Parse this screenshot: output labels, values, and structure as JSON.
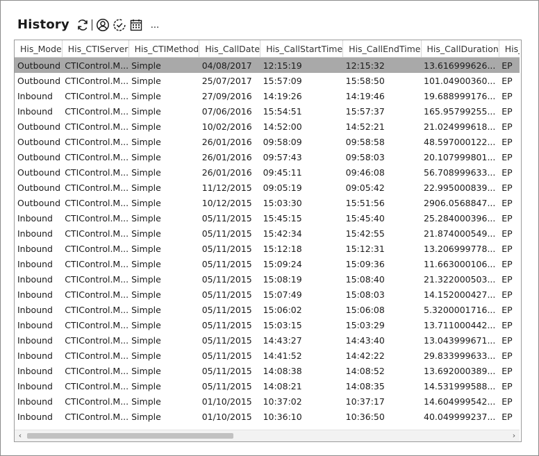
{
  "title": "History",
  "toolbar": {
    "buttons": [
      {
        "name": "refresh-icon"
      },
      {
        "name": "user-circle-icon"
      },
      {
        "name": "check-circle-icon"
      },
      {
        "name": "calendar-icon"
      }
    ],
    "more_label": "..."
  },
  "grid": {
    "columns": [
      "His_Mode",
      "His_CTIServer",
      "His_CTIMethod",
      "His_CallDate",
      "His_CallStartTime",
      "His_CallEndTime",
      "His_CallDuration",
      "His_"
    ],
    "selected_row": 0,
    "rows": [
      [
        "Outbound",
        "CTIControl.M...",
        "Simple",
        "04/08/2017",
        "12:15:19",
        "12:15:32",
        "13.616999626...",
        "EP"
      ],
      [
        "Outbound",
        "CTIControl.M...",
        "Simple",
        "25/07/2017",
        "15:57:09",
        "15:58:50",
        "101.04900360...",
        "EP"
      ],
      [
        "Inbound",
        "CTIControl.M...",
        "Simple",
        "27/09/2016",
        "14:19:26",
        "14:19:46",
        "19.688999176...",
        "EP"
      ],
      [
        "Inbound",
        "CTIControl.M...",
        "Simple",
        "07/06/2016",
        "15:54:51",
        "15:57:37",
        "165.95799255...",
        "EP"
      ],
      [
        "Outbound",
        "CTIControl.M...",
        "Simple",
        "10/02/2016",
        "14:52:00",
        "14:52:21",
        "21.024999618...",
        "EP"
      ],
      [
        "Outbound",
        "CTIControl.M...",
        "Simple",
        "26/01/2016",
        "09:58:09",
        "09:58:58",
        "48.597000122...",
        "EP"
      ],
      [
        "Outbound",
        "CTIControl.M...",
        "Simple",
        "26/01/2016",
        "09:57:43",
        "09:58:03",
        "20.107999801...",
        "EP"
      ],
      [
        "Outbound",
        "CTIControl.M...",
        "Simple",
        "26/01/2016",
        "09:45:11",
        "09:46:08",
        "56.708999633...",
        "EP"
      ],
      [
        "Outbound",
        "CTIControl.M...",
        "Simple",
        "11/12/2015",
        "09:05:19",
        "09:05:42",
        "22.995000839...",
        "EP"
      ],
      [
        "Outbound",
        "CTIControl.M...",
        "Simple",
        "10/12/2015",
        "15:03:30",
        "15:51:56",
        "2906.0568847...",
        "EP"
      ],
      [
        "Inbound",
        "CTIControl.M...",
        "Simple",
        "05/11/2015",
        "15:45:15",
        "15:45:40",
        "25.284000396...",
        "EP"
      ],
      [
        "Inbound",
        "CTIControl.M...",
        "Simple",
        "05/11/2015",
        "15:42:34",
        "15:42:55",
        "21.874000549...",
        "EP"
      ],
      [
        "Inbound",
        "CTIControl.M...",
        "Simple",
        "05/11/2015",
        "15:12:18",
        "15:12:31",
        "13.206999778...",
        "EP"
      ],
      [
        "Inbound",
        "CTIControl.M...",
        "Simple",
        "05/11/2015",
        "15:09:24",
        "15:09:36",
        "11.663000106...",
        "EP"
      ],
      [
        "Inbound",
        "CTIControl.M...",
        "Simple",
        "05/11/2015",
        "15:08:19",
        "15:08:40",
        "21.322000503...",
        "EP"
      ],
      [
        "Inbound",
        "CTIControl.M...",
        "Simple",
        "05/11/2015",
        "15:07:49",
        "15:08:03",
        "14.152000427...",
        "EP"
      ],
      [
        "Inbound",
        "CTIControl.M...",
        "Simple",
        "05/11/2015",
        "15:06:02",
        "15:06:08",
        "5.3200001716...",
        "EP"
      ],
      [
        "Inbound",
        "CTIControl.M...",
        "Simple",
        "05/11/2015",
        "15:03:15",
        "15:03:29",
        "13.711000442...",
        "EP"
      ],
      [
        "Inbound",
        "CTIControl.M...",
        "Simple",
        "05/11/2015",
        "14:43:27",
        "14:43:40",
        "13.043999671...",
        "EP"
      ],
      [
        "Inbound",
        "CTIControl.M...",
        "Simple",
        "05/11/2015",
        "14:41:52",
        "14:42:22",
        "29.833999633...",
        "EP"
      ],
      [
        "Inbound",
        "CTIControl.M...",
        "Simple",
        "05/11/2015",
        "14:08:38",
        "14:08:52",
        "13.692000389...",
        "EP"
      ],
      [
        "Inbound",
        "CTIControl.M...",
        "Simple",
        "05/11/2015",
        "14:08:21",
        "14:08:35",
        "14.531999588...",
        "EP"
      ],
      [
        "Inbound",
        "CTIControl.M...",
        "Simple",
        "01/10/2015",
        "10:37:02",
        "10:37:17",
        "14.604999542...",
        "EP"
      ],
      [
        "Inbound",
        "CTIControl.M...",
        "Simple",
        "01/10/2015",
        "10:36:10",
        "10:36:50",
        "40.049999237...",
        "EP"
      ]
    ]
  },
  "scrollbar": {
    "left_arrow": "‹",
    "right_arrow": "›"
  }
}
